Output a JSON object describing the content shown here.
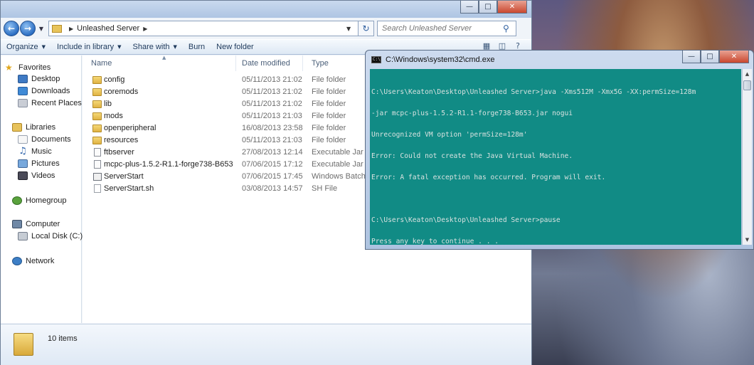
{
  "explorer": {
    "address": {
      "crumb": "Unleashed Server"
    },
    "search": {
      "placeholder": "Search Unleashed Server"
    },
    "toolbar": {
      "organize": "Organize",
      "include_in_library": "Include in library",
      "share_with": "Share with",
      "burn": "Burn",
      "new_folder": "New folder"
    },
    "nav": {
      "favorites": "Favorites",
      "desktop": "Desktop",
      "downloads": "Downloads",
      "recent_places": "Recent Places",
      "libraries": "Libraries",
      "documents": "Documents",
      "music": "Music",
      "pictures": "Pictures",
      "videos": "Videos",
      "homegroup": "Homegroup",
      "computer": "Computer",
      "local_disk": "Local Disk (C:)",
      "network": "Network"
    },
    "columns": {
      "name": "Name",
      "date_modified": "Date modified",
      "type": "Type"
    },
    "files": [
      {
        "name": "config",
        "date": "05/11/2013 21:02",
        "type": "File folder"
      },
      {
        "name": "coremods",
        "date": "05/11/2013 21:02",
        "type": "File folder"
      },
      {
        "name": "lib",
        "date": "05/11/2013 21:02",
        "type": "File folder"
      },
      {
        "name": "mods",
        "date": "05/11/2013 21:03",
        "type": "File folder"
      },
      {
        "name": "openperipheral",
        "date": "16/08/2013 23:58",
        "type": "File folder"
      },
      {
        "name": "resources",
        "date": "05/11/2013 21:03",
        "type": "File folder"
      },
      {
        "name": "ftbserver",
        "date": "27/08/2013 12:14",
        "type": "Executable Jar File"
      },
      {
        "name": "mcpc-plus-1.5.2-R1.1-forge738-B653",
        "date": "07/06/2015 17:12",
        "type": "Executable Jar File"
      },
      {
        "name": "ServerStart",
        "date": "07/06/2015 17:45",
        "type": "Windows Batch File"
      },
      {
        "name": "ServerStart.sh",
        "date": "03/08/2013 14:57",
        "type": "SH File"
      }
    ],
    "status": {
      "item_count": "10 items"
    }
  },
  "cmd": {
    "title": "C:\\Windows\\system32\\cmd.exe",
    "icon_text": "C:\\",
    "lines": {
      "l1": "C:\\Users\\Keaton\\Desktop\\Unleashed Server>java -Xms512M -Xmx5G -XX:permSize=128m",
      "l2": "-jar mcpc-plus-1.5.2-R1.1-forge738-B653.jar nogui",
      "l3": "Unrecognized VM option 'permSize=128m'",
      "l4": "Error: Could not create the Java Virtual Machine.",
      "l5": "Error: A fatal exception has occurred. Program will exit.",
      "l6": "C:\\Users\\Keaton\\Desktop\\Unleashed Server>pause",
      "l7": "Press any key to continue . . ."
    }
  },
  "colors": {
    "console_bg": "#118b85",
    "console_text": "#d8e2e0",
    "window_frame": "#aec3e0"
  }
}
